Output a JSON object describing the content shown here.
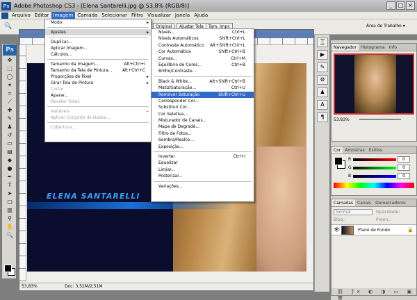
{
  "window": {
    "title": "Adobe Photoshop CS3 - [Elena Santarelli.jpg @ 53,8% (RGB/8)]",
    "logo": "Ps",
    "controls": [
      "_",
      "□",
      "×"
    ]
  },
  "menubar": [
    "Arquivo",
    "Editar",
    "Imagem",
    "Camada",
    "Selecionar",
    "Filtro",
    "Visualizar",
    "Janela",
    "Ajuda"
  ],
  "options": {
    "buttons": [
      "Original",
      "Ajustar Tela",
      "Tam. Impr."
    ],
    "workspace": "Área de Trabalho ▾"
  },
  "imagem_menu": [
    {
      "label": "Modo",
      "submenu": true
    },
    {
      "sep": true
    },
    {
      "label": "Ajustes",
      "submenu": true,
      "highlight": true
    },
    {
      "sep": true
    },
    {
      "label": "Duplicar..."
    },
    {
      "label": "Aplicar Imagem..."
    },
    {
      "label": "Cálculos..."
    },
    {
      "sep": true
    },
    {
      "label": "Tamanho da Imagem...",
      "shortcut": "Alt+Ctrl+I"
    },
    {
      "label": "Tamanho da Tela de Pintura...",
      "shortcut": "Alt+Ctrl+C"
    },
    {
      "label": "Proporções de Pixel",
      "submenu": true
    },
    {
      "label": "Girar Tela de Pintura",
      "submenu": true
    },
    {
      "label": "Cortar",
      "disabled": true
    },
    {
      "label": "Aparar..."
    },
    {
      "label": "Revelar Todas",
      "disabled": true
    },
    {
      "sep": true
    },
    {
      "label": "Variáveis",
      "submenu": true,
      "disabled": true
    },
    {
      "label": "Aplicar Conjunto de Dados...",
      "disabled": true
    },
    {
      "sep": true
    },
    {
      "label": "Cobertura...",
      "disabled": true
    }
  ],
  "ajustes_menu": [
    {
      "label": "Níveis...",
      "shortcut": "Ctrl+L"
    },
    {
      "label": "Níveis Automáticos",
      "shortcut": "Shift+Ctrl+L"
    },
    {
      "label": "Contraste Automático",
      "shortcut": "Alt+Shift+Ctrl+L"
    },
    {
      "label": "Cor Automática",
      "shortcut": "Shift+Ctrl+B"
    },
    {
      "label": "Curvas...",
      "shortcut": "Ctrl+M"
    },
    {
      "label": "Equilíbrio de Cores...",
      "shortcut": "Ctrl+B"
    },
    {
      "label": "Brilho/Contraste..."
    },
    {
      "sep": true
    },
    {
      "label": "Black & White...",
      "shortcut": "Alt+Shift+Ctrl+B"
    },
    {
      "label": "Matiz/Saturação...",
      "shortcut": "Ctrl+U"
    },
    {
      "label": "Remover Saturação",
      "shortcut": "Shift+Ctrl+U",
      "highlight": true
    },
    {
      "label": "Corresponder Cor..."
    },
    {
      "label": "Substituir Cor..."
    },
    {
      "label": "Cor Seletiva..."
    },
    {
      "label": "Misturador de Canais..."
    },
    {
      "label": "Mapa de Degradê..."
    },
    {
      "label": "Filtro de Fotos..."
    },
    {
      "label": "Sombra/Realce..."
    },
    {
      "label": "Exposição..."
    },
    {
      "sep": true
    },
    {
      "label": "Inverter",
      "shortcut": "Ctrl+I"
    },
    {
      "label": "Equalizar"
    },
    {
      "label": "Limiar..."
    },
    {
      "label": "Posterizar..."
    },
    {
      "sep": true
    },
    {
      "label": "Variações..."
    }
  ],
  "canvas": {
    "title_art": "ELENA SANTARELLI"
  },
  "statusbar": {
    "zoom": "53,83%",
    "doc": "Doc: 3,52M/2,51M"
  },
  "navigator": {
    "tabs": [
      "Navegador",
      "Histograma",
      "Info"
    ],
    "zoom": "53.83%"
  },
  "color_panel": {
    "tabs": [
      "Cor",
      "Amostras",
      "Estilos"
    ],
    "channels": [
      {
        "label": "R",
        "value": "0"
      },
      {
        "label": "G",
        "value": "0"
      },
      {
        "label": "B",
        "value": "0"
      }
    ]
  },
  "layers_panel": {
    "tabs": [
      "Camadas",
      "Canais",
      "Demarcadores"
    ],
    "blend": "Normal",
    "opacity": "Opacidade:",
    "lock": "Bloq.:",
    "fill": "Preen.:",
    "layer_name": "Plano de Fundo"
  }
}
